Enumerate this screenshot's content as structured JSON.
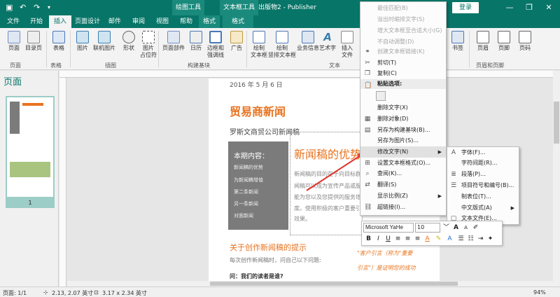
{
  "titlebar": {
    "save_icon": "save-icon",
    "context1": "绘图工具",
    "context2": "文本框工具",
    "doc_title": "出版物2 - Publisher",
    "login": "登录",
    "min": "—",
    "restore": "❐",
    "close": "✕"
  },
  "tabs": [
    "文件",
    "开始",
    "插入",
    "页面设计",
    "邮件",
    "审阅",
    "视图",
    "帮助",
    "格式",
    "格式"
  ],
  "ribbon": {
    "buttons": [
      "页面",
      "目录页",
      "表格",
      "图片",
      "联机图片",
      "形状",
      "图片\n占位符",
      "页面部件",
      "日历",
      "边框和\n强调线",
      "广告",
      "绘制\n文本框",
      "绘制\n竖排文本框",
      "业务信息",
      "艺术字",
      "插入\n文件",
      "书签",
      "页眉",
      "页脚",
      "页码"
    ],
    "groups": [
      "页面",
      "表格",
      "插图",
      "构建基块",
      "文本",
      "页眉和页脚"
    ]
  },
  "leftpane": {
    "title": "页面",
    "page_num": "1"
  },
  "doc": {
    "date": "2016 年 5 月 6 日",
    "title": "贸易商新闻",
    "subtitle": "罗斯文商贸公司新闻稿",
    "box_title": "本期内容：",
    "box_items": [
      "新闻稿的优势",
      "为新闻稿增值",
      "第二条新闻",
      "另一条新闻",
      "对面新闻"
    ],
    "story_title": "新闻稿的优势",
    "story_lines": [
      "新闻稿的目的在于向目标群",
      "闻稿可以成为宣传产品或服",
      "能为您以及您提供的服务增",
      "度。使用积极的客户重要引",
      "效果。"
    ],
    "section_head": "关于创作新闻稿的提示",
    "section_body": "每次创作新闻稿时，问自己以下问题:",
    "section_q": "问：我们的读者是谁?",
    "quote1": "\"客户引言（称为\"重要",
    "quote2": "引言\"）是证明您的成功"
  },
  "context_menu": {
    "items": [
      {
        "label": "最佳匹配(B)",
        "disabled": true
      },
      {
        "label": "溢出时缩排文字(S)",
        "disabled": true
      },
      {
        "label": "增大文本框至合适大小(G)",
        "disabled": true
      },
      {
        "label": "不自动调整(D)",
        "disabled": true
      },
      {
        "label": "创建文本框链接(K)",
        "disabled": true
      },
      {
        "label": "剪切(T)",
        "disabled": false
      },
      {
        "label": "复制(C)",
        "disabled": false
      },
      {
        "label": "粘贴选项:",
        "disabled": false
      },
      {
        "label": "删除文字(X)",
        "disabled": false
      },
      {
        "label": "删除对象(D)",
        "disabled": false
      },
      {
        "label": "另存为构建基块(B)...",
        "disabled": false
      },
      {
        "label": "另存为图片(S)...",
        "disabled": false
      },
      {
        "label": "修改文字(N)",
        "disabled": false
      },
      {
        "label": "设置文本框格式(O)...",
        "disabled": false
      },
      {
        "label": "查阅(K)...",
        "disabled": false
      },
      {
        "label": "翻译(S)",
        "disabled": false
      },
      {
        "label": "显示比例(Z)",
        "disabled": false
      },
      {
        "label": "超链接(I)...",
        "disabled": false
      }
    ]
  },
  "submenu": {
    "items": [
      "字体(F)...",
      "字符间距(R)...",
      "段落(P)...",
      "项目符号和编号(B)...",
      "制表位(T)...",
      "中文版式(A)",
      "文本文件(E)..."
    ]
  },
  "minitoolbar": {
    "font": "Microsoft YaHe",
    "size": "10",
    "bold": "B",
    "italic": "I",
    "underline": "U"
  },
  "statusbar": {
    "page": "页面: 1/1",
    "position": "2.13, 2.07 英寸",
    "size": "3.17 x 2.34 英寸",
    "zoom": "94%"
  },
  "colors": {
    "accent": "#077568",
    "orange": "#e8731f",
    "gray": "#7b7b7b"
  }
}
